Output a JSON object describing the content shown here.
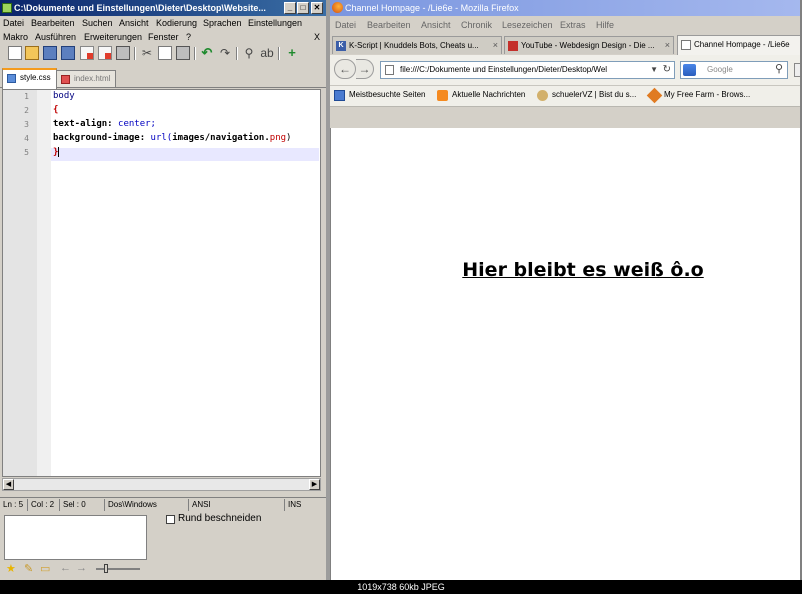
{
  "npp": {
    "title": "C:\\Dokumente und Einstellungen\\Dieter\\Desktop\\Website...",
    "menu_row1": [
      "Datei",
      "Bearbeiten",
      "Suchen",
      "Ansicht",
      "Kodierung",
      "Sprachen",
      "Einstellungen"
    ],
    "menu_row2": [
      "Makro",
      "Ausführen",
      "Erweiterungen",
      "Fenster",
      "?"
    ],
    "close_x": "X",
    "tabs": [
      {
        "label": "style.css",
        "active": true
      },
      {
        "label": "index.html",
        "active": false
      }
    ],
    "line_numbers": [
      "1",
      "2",
      "3",
      "4",
      "5"
    ],
    "code": {
      "l1": "body",
      "l2": "{",
      "l3_prop": "text-align:",
      "l3_val": "center;",
      "l4_prop": "background-image:",
      "l4_fn": "url(",
      "l4_path": "images/navigation.",
      "l4_ext": "png",
      "l4_end": ")",
      "l5": "}"
    },
    "status": {
      "ln": "Ln : 5",
      "col": "Col : 2",
      "sel": "Sel : 0",
      "eol": "Dos\\Windows",
      "enc": "ANSI",
      "mode": "INS"
    },
    "rund_label": "Rund beschneiden"
  },
  "firefox": {
    "title": "Channel Hompage - /Lie6e - Mozilla Firefox",
    "menu": [
      "Datei",
      "Bearbeiten",
      "Ansicht",
      "Chronik",
      "Lesezeichen",
      "Extras",
      "Hilfe"
    ],
    "tabs": [
      {
        "label": "K-Script | Knuddels Bots, Cheats u...",
        "icon": "k-icon"
      },
      {
        "label": "YouTube - Webdesign Design - Die ...",
        "icon": "youtube-icon"
      },
      {
        "label": "Channel Hompage - /Lie6e",
        "icon": "page-icon",
        "active": true
      }
    ],
    "tab_close": "×",
    "url": "file:///C:/Dokumente und Einstellungen/Dieter/Desktop/Wel",
    "search_placeholder": "Google",
    "bookmarks": [
      "Meistbesuchte Seiten",
      "Aktuelle Nachrichten",
      "schuelerVZ | Bist du s...",
      "My Free Farm - Brows..."
    ],
    "page_heading": "Hier bleibt es weiß ô.o"
  },
  "caption": "1019x738  60kb  JPEG"
}
